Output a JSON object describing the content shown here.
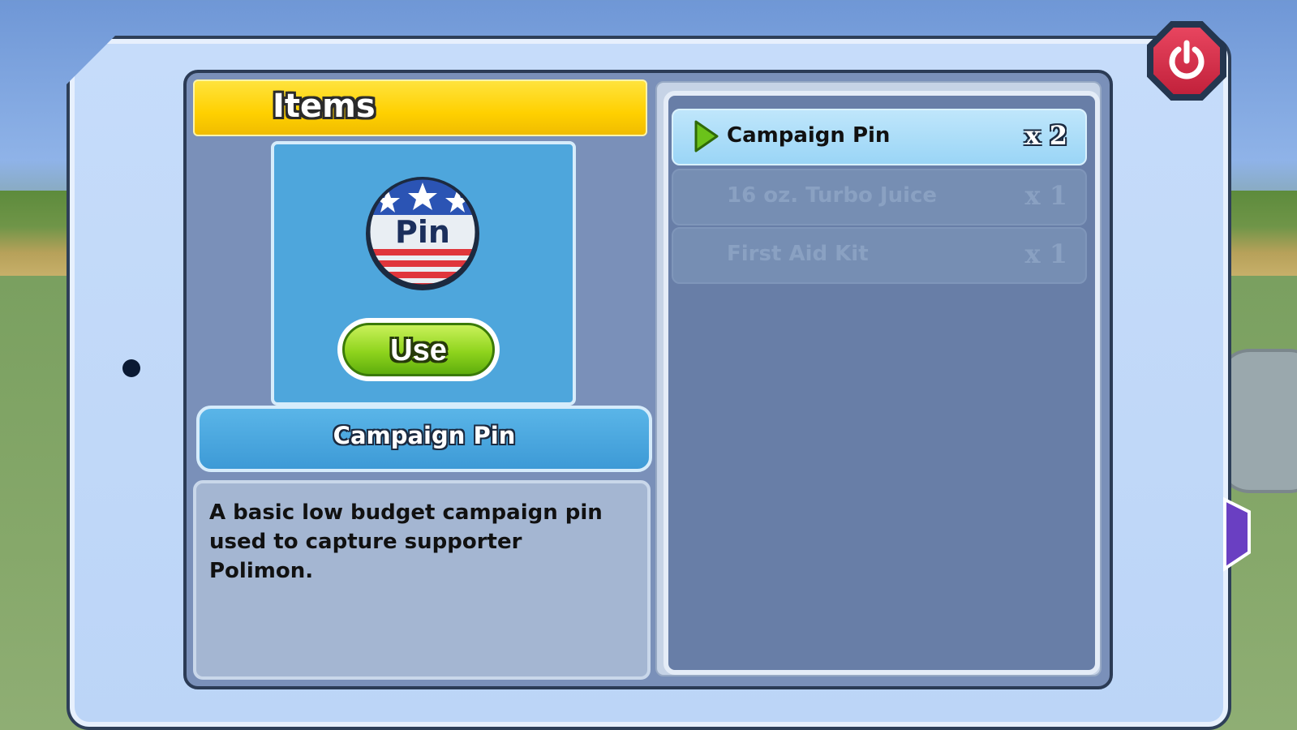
{
  "header": {
    "title": "Items"
  },
  "selected_item": {
    "icon_text": "Pin",
    "use_label": "Use",
    "name": "Campaign Pin",
    "description": "A basic low budget campaign pin used to capture supporter Polimon."
  },
  "inventory": {
    "items": [
      {
        "name": "Campaign Pin",
        "qty": "x 2",
        "state": "selected"
      },
      {
        "name": "16 oz. Turbo Juice",
        "qty": "x 1",
        "state": "disabled"
      },
      {
        "name": "First Aid Kit",
        "qty": "x 1",
        "state": "disabled"
      }
    ]
  },
  "colors": {
    "title_bar": "#ffd000",
    "preview_bg": "#4ea6dc",
    "use_button": "#8fd41d",
    "power_button": "#d6304a",
    "selected_row": "#a8dbf7"
  },
  "icons": {
    "power": "power-icon",
    "selection_arrow": "play-arrow-icon",
    "item_icon": "campaign-pin-badge-icon"
  }
}
